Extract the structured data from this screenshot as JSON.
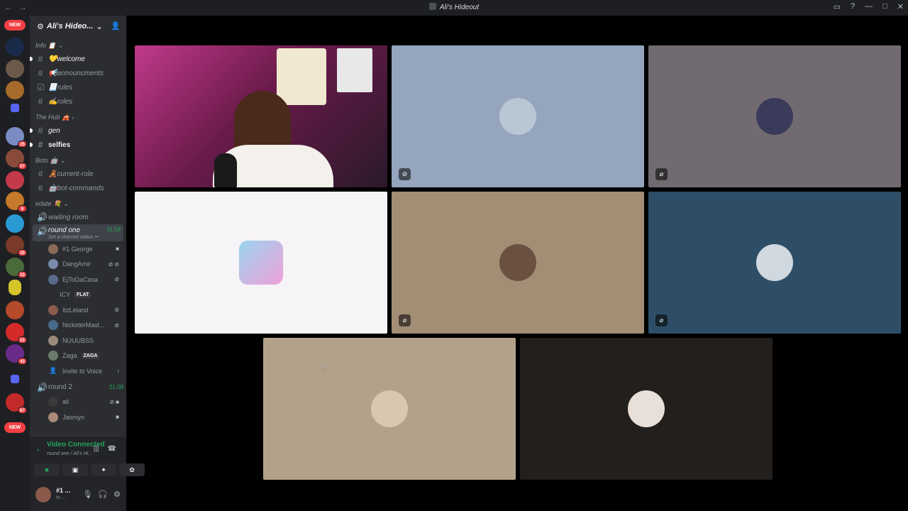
{
  "window": {
    "title": "Ali's Hideout"
  },
  "rail": {
    "new_top": "NEW",
    "new_bottom": "NEW",
    "badges": [
      "25",
      "57",
      "8",
      "30",
      "33",
      "23",
      "43",
      "67"
    ]
  },
  "server": {
    "name": "Ali's Hideo..."
  },
  "categories": {
    "info": "Info 📋",
    "hub": "The Hub 🎪",
    "bots": "Bots 🤖",
    "edate": "edate 💐"
  },
  "channels": {
    "welcome": "💛welcome",
    "announcments": "📢announcments",
    "rules": "📃rules",
    "roles": "✍️roles",
    "gen": "gen",
    "selfies": "selfies",
    "current_role": "🧸current-role",
    "bot_commands": "🤖bot-commands",
    "waiting_room": "waiting room",
    "round_one": "round one",
    "round_one_timer": "31:58",
    "round_one_status": "Set a channel status ✏",
    "round_two": "round 2",
    "round_two_timer": "21:08",
    "invite": "Invite to Voice"
  },
  "voice_users": {
    "george": "#1 George",
    "dangamir": "DangAmir",
    "ejtodacasa": "EjToDaCasa",
    "icy": "ICY",
    "icy_tag": "FLAT",
    "itzleland": "ItzLeland",
    "nickster": "NicksterMast...",
    "nuuubss": "NUUUBSS",
    "zaga": "Zaga",
    "zaga_tag": "ZAGA",
    "ali": "ali",
    "jasmyn": "Jasmyn"
  },
  "voice_panel": {
    "status": "Video Connected",
    "sub": "round one / Ali's Hi..."
  },
  "user_panel": {
    "name": "#1 ...",
    "sub": "In ..."
  },
  "colors": {
    "accent_green": "#23a559",
    "red": "#f23f43",
    "sidebar": "#2b2d31",
    "rail": "#1e1f22"
  },
  "tiles": [
    {
      "name": "streamer-tile",
      "bg": "#7a2a5a",
      "muted": false
    },
    {
      "name": "tile-2",
      "bg": "#94a5bd",
      "muted": true,
      "icon": "video-off-icon"
    },
    {
      "name": "tile-3",
      "bg": "#716a70",
      "muted": true,
      "icon": "mic-off-icon"
    },
    {
      "name": "tile-4",
      "bg": "#f6f4f6",
      "muted": false
    },
    {
      "name": "tile-5",
      "bg": "#a38d75",
      "muted": true,
      "icon": "mic-off-icon"
    },
    {
      "name": "tile-6",
      "bg": "#2e4e67",
      "muted": true,
      "icon": "mic-off-icon"
    },
    {
      "name": "tile-7",
      "bg": "#b3a28a",
      "muted": false
    },
    {
      "name": "tile-8",
      "bg": "#221f1d",
      "muted": false
    }
  ]
}
